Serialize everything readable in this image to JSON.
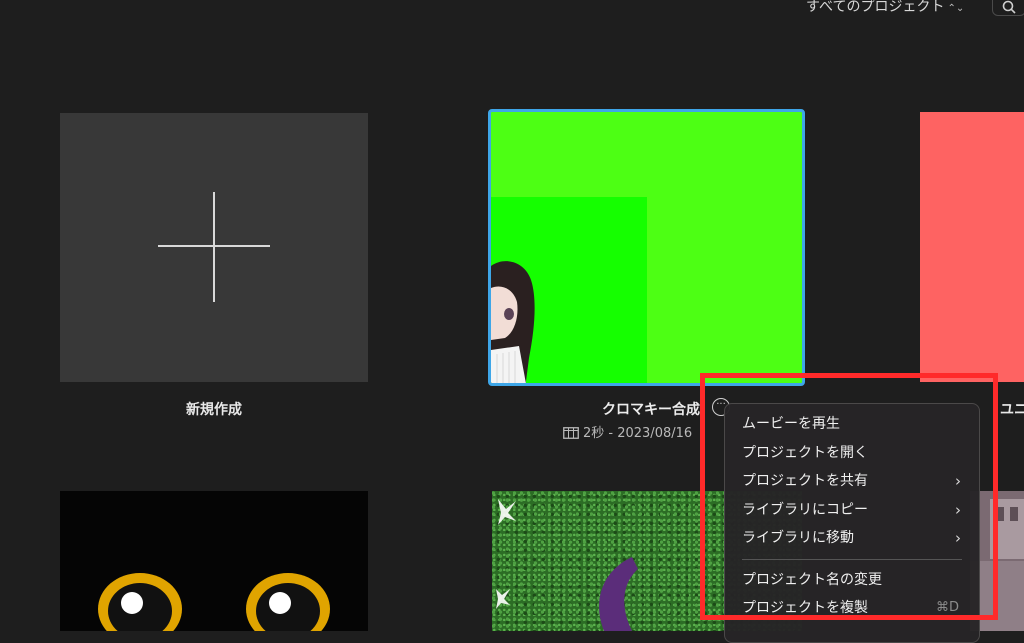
{
  "filter": {
    "label": "すべてのプロジェクト"
  },
  "new_project": {
    "label": "新規作成"
  },
  "projects": [
    {
      "title": "クロマキー合成",
      "meta": "2秒 - 2023/08/16"
    },
    {
      "title": "ユニ"
    }
  ],
  "context_menu": {
    "items": [
      {
        "label": "ムービーを再生"
      },
      {
        "label": "プロジェクトを開く"
      },
      {
        "label": "プロジェクトを共有",
        "submenu": true
      },
      {
        "label": "ライブラリにコピー",
        "submenu": true
      },
      {
        "label": "ライブラリに移動",
        "submenu": true
      },
      {
        "label": "プロジェクト名の変更"
      },
      {
        "label": "プロジェクトを複製",
        "shortcut": "⌘D"
      }
    ]
  },
  "colors": {
    "background": "#1e1e1e",
    "selection_border": "#3ea6e8",
    "annotation_red": "#ff2a2a",
    "chroma_green": "#4dff14",
    "salmon_tile": "#fe6362"
  },
  "icons": [
    "search-icon",
    "chevron-updown-icon",
    "plus-icon",
    "more-icon",
    "film-icon",
    "chevron-right-icon"
  ]
}
